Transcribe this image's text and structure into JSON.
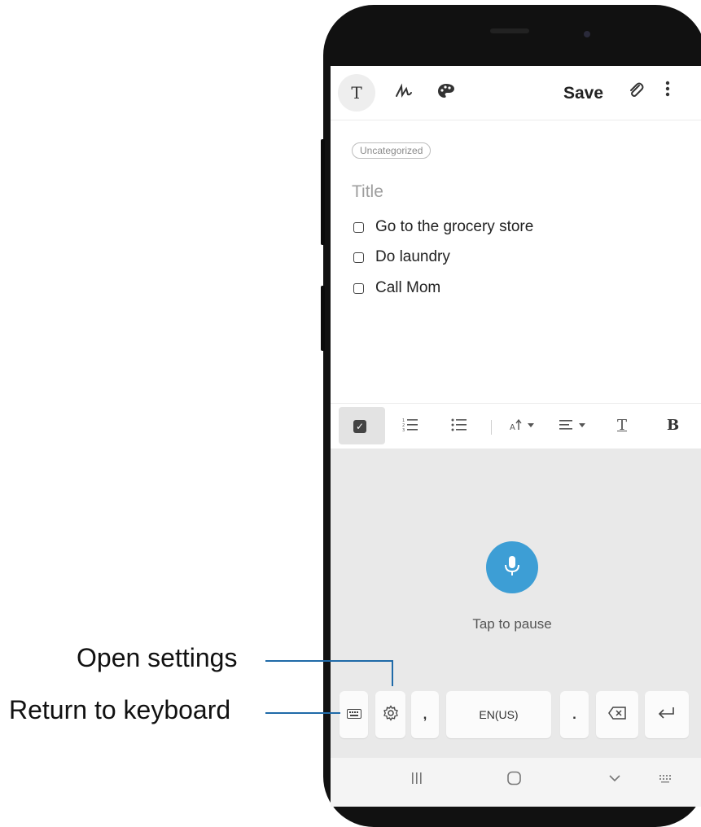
{
  "toolbar": {
    "text_mode_icon_glyph": "T",
    "save_label": "Save"
  },
  "note": {
    "category": "Uncategorized",
    "title_placeholder": "Title",
    "checklist": [
      {
        "label": "Go to the grocery store",
        "checked": false
      },
      {
        "label": "Do laundry",
        "checked": false
      },
      {
        "label": "Call Mom",
        "checked": false
      }
    ]
  },
  "format_bar": {
    "bold_glyph": "B",
    "text_style_glyph": "T"
  },
  "voice_input": {
    "status": "Tap to pause",
    "accent_color": "#3d9ed5"
  },
  "keyboard_row": {
    "comma": ",",
    "language": "EN(US)",
    "period": "."
  },
  "callouts": {
    "open_settings": "Open settings",
    "return_to_keyboard": "Return to keyboard"
  },
  "icons": {
    "text-mode": "T",
    "handwriting": "pen-scribble",
    "drawing": "palette",
    "attach": "paperclip",
    "more": "vertical-dots",
    "checkbox-list": "checkbox",
    "numbered-list": "numbered-list",
    "bullet-list": "bullet-list",
    "font-size": "font-size-dropdown",
    "align": "align-dropdown",
    "keyboard": "keyboard",
    "settings": "gear",
    "backspace": "backspace",
    "enter": "enter",
    "mic": "microphone"
  }
}
